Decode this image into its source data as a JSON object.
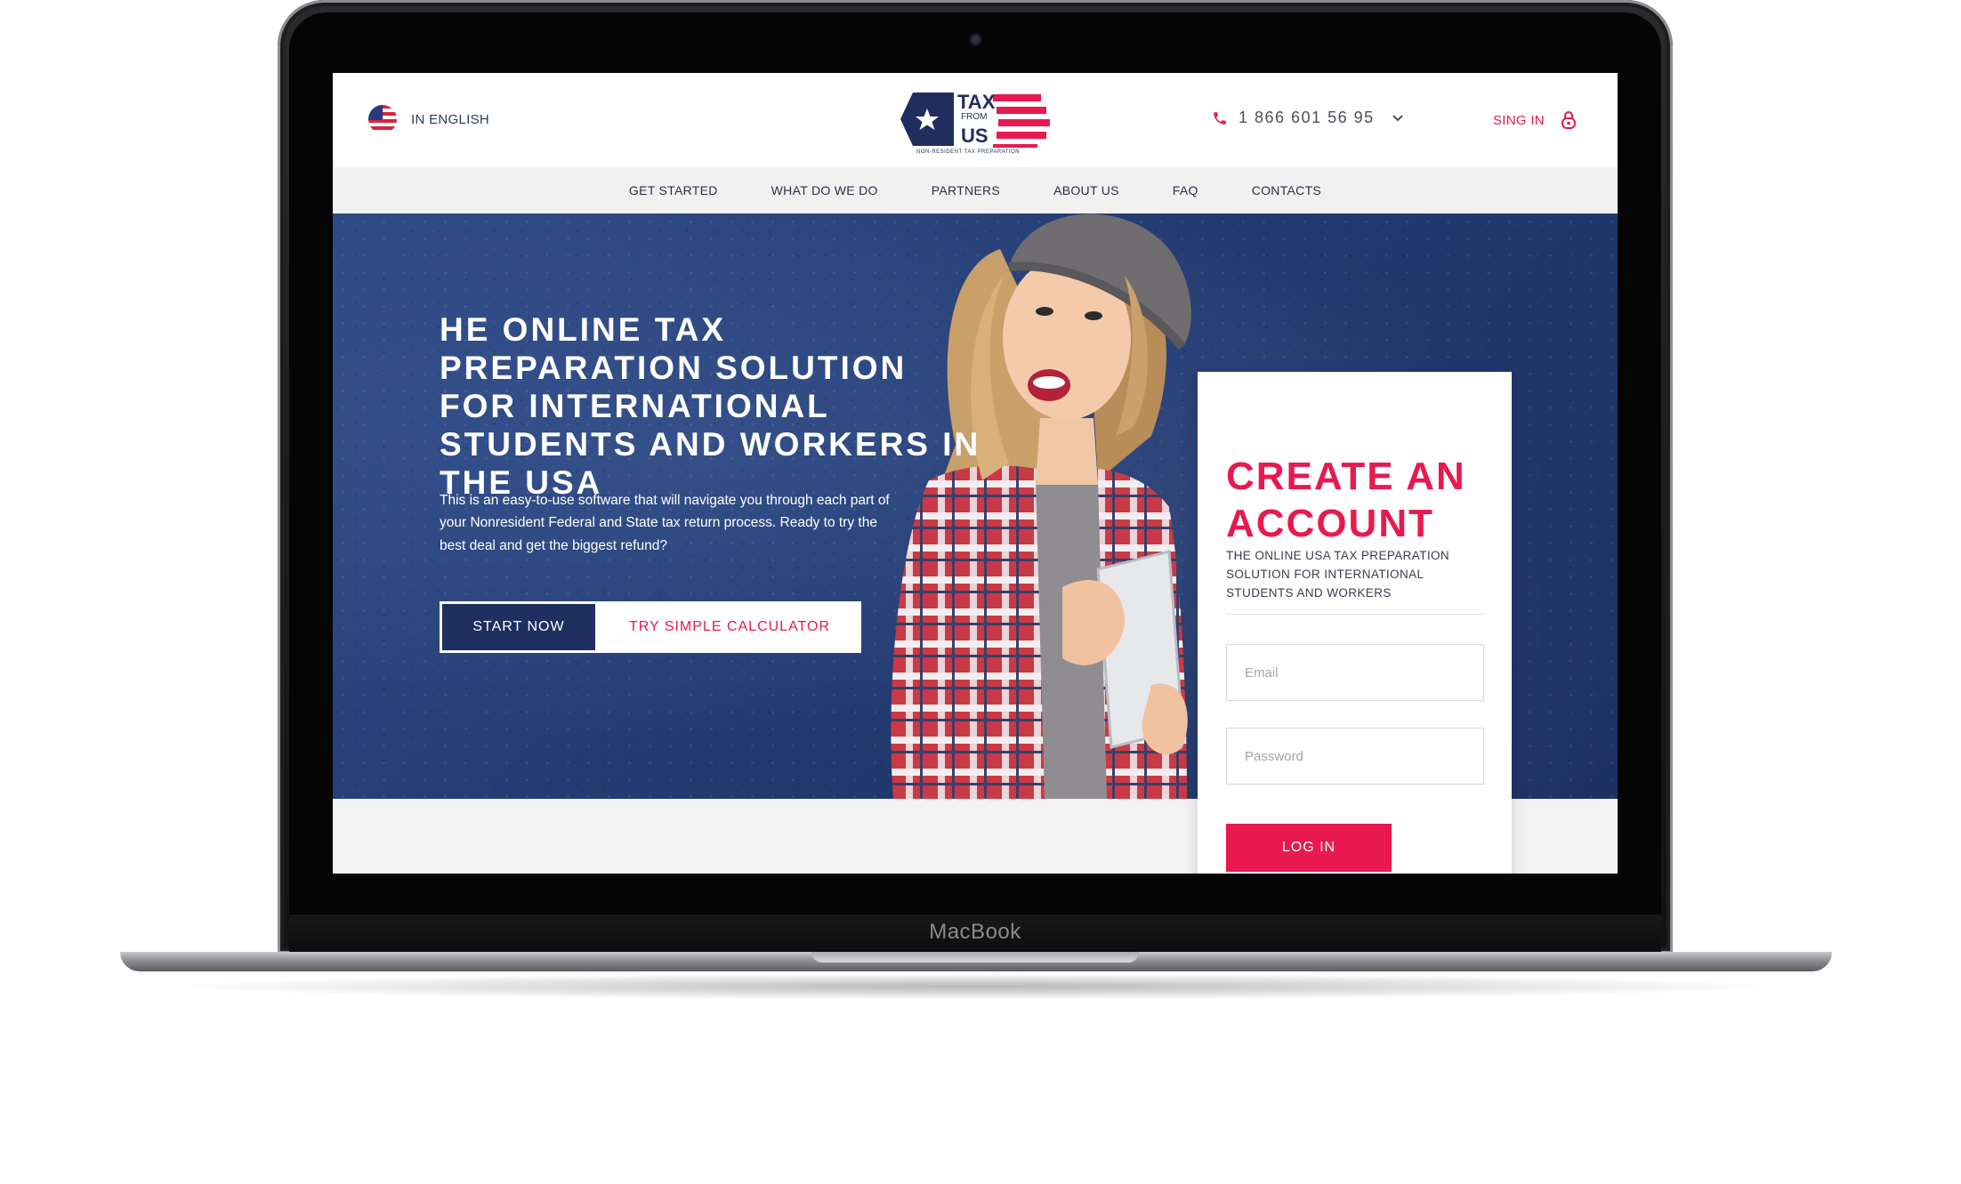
{
  "device": {
    "label": "MacBook"
  },
  "header": {
    "language_label": "IN ENGLISH",
    "logo": {
      "tax": "TAX",
      "from": "FROM",
      "us": "US",
      "tagline": "NON-RESIDENT TAX PREPARATION"
    },
    "phone_number": "1 866 601 56 95",
    "signin_label": "SING IN"
  },
  "nav": {
    "items": [
      {
        "label": "GET STARTED"
      },
      {
        "label": "WHAT DO WE DO"
      },
      {
        "label": "PARTNERS"
      },
      {
        "label": "ABOUT US"
      },
      {
        "label": "FAQ"
      },
      {
        "label": "CONTACTS"
      }
    ]
  },
  "hero": {
    "title": "HE ONLINE TAX PREPARATION SOLUTION FOR INTERNATIONAL STUDENTS AND WORKERS IN THE USA",
    "description": "This is an easy-to-use software that will navigate you through each part of your Nonresident Federal and State tax return process. Ready to try the best deal and get the biggest refund?",
    "start_button": "START NOW",
    "calculator_button": "TRY SIMPLE CALCULATOR"
  },
  "account": {
    "title": "CREATE AN ACCOUNT",
    "subtitle": "THE ONLINE USA TAX PREPARATION SOLUTION FOR INTERNATIONAL STUDENTS AND WORKERS",
    "email_placeholder": "Email",
    "password_placeholder": "Password",
    "login_button": "LOG IN"
  },
  "colors": {
    "accent": "#e8194f",
    "navy": "#1f2e5e",
    "hero_blue": "#243c74",
    "nav_bg": "#f1f1f1"
  },
  "icons": {
    "flag": "us-flag-icon",
    "phone": "phone-icon",
    "dropdown": "chevron-down-icon",
    "lock": "lock-icon",
    "logo_star": "star-icon"
  }
}
